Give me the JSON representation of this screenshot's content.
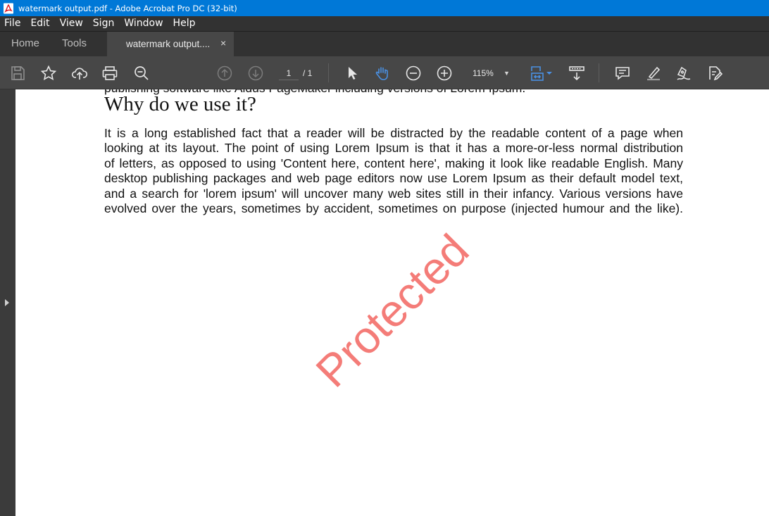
{
  "window": {
    "title": "watermark output.pdf - Adobe Acrobat Pro DC (32-bit)"
  },
  "menu": [
    "File",
    "Edit",
    "View",
    "Sign",
    "Window",
    "Help"
  ],
  "tabs": {
    "home": "Home",
    "tools": "Tools",
    "document": "watermark output....",
    "close": "×"
  },
  "toolbar": {
    "page_current": "1",
    "page_total": "/ 1",
    "zoom": "115%",
    "zoom_caret": "▼",
    "icons": [
      "save-icon",
      "bookmark-star-icon",
      "upload-cloud-icon",
      "print-icon",
      "find-zoom-icon",
      "prev-page-icon",
      "next-page-icon",
      "select-arrow-icon",
      "hand-icon",
      "zoom-out-icon",
      "zoom-in-icon",
      "fit-page-icon",
      "scroll-mode-icon",
      "comment-icon",
      "highlight-icon",
      "sign-icon",
      "edit-pdf-icon"
    ]
  },
  "document": {
    "cut_line": "publishing software like Aldus PageMaker including versions of Lorem Ipsum.",
    "heading": "Why do we use it?",
    "paragraph_lines": [
      "It is a long established fact that a reader will be distracted by the readable content of a page when",
      "looking at its layout. The point of using Lorem Ipsum is that it has a more-or-less normal distribution",
      "of letters, as opposed to using 'Content here, content here', making it look like readable English. Many",
      "desktop publishing packages and web page editors now use Lorem Ipsum as their default model text,",
      "and a search for 'lorem ipsum' will uncover many web sites still in their infancy. Various versions have",
      "evolved over the years, sometimes by accident, sometimes on purpose (injected humour and the like)."
    ],
    "watermark": "Protected"
  },
  "colors": {
    "titlebar": "#0078d7",
    "menubar": "#323232",
    "toolbar": "#474747",
    "active_tool": "#4a90e2",
    "watermark": "#f47c78"
  }
}
